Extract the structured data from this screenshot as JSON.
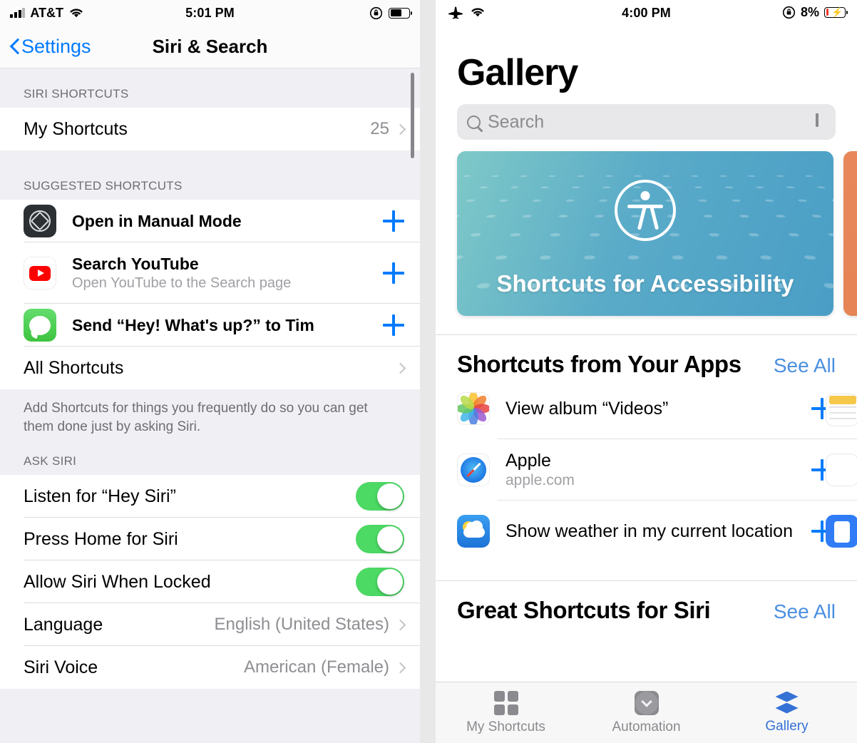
{
  "left": {
    "status": {
      "carrier": "AT&T",
      "time": "5:01 PM"
    },
    "nav": {
      "back": "Settings",
      "title": "Siri & Search"
    },
    "groups": [
      {
        "header": "SIRI SHORTCUTS",
        "rows": [
          {
            "title": "My Shortcuts",
            "value": "25"
          }
        ]
      },
      {
        "header": "SUGGESTED SHORTCUTS",
        "rows": [
          {
            "title": "Open in Manual Mode",
            "sub": "",
            "icon": "halide-icon"
          },
          {
            "title": "Search YouTube",
            "sub": "Open YouTube to the Search page",
            "icon": "youtube-icon"
          },
          {
            "title": "Send “Hey! What's up?” to Tim",
            "sub": "",
            "icon": "messages-icon"
          },
          {
            "title": "All Shortcuts"
          }
        ]
      }
    ],
    "footer_note": "Add Shortcuts for things you frequently do so you can get them done just by asking Siri.",
    "ask_siri_header": "ASK SIRI",
    "ask_siri_rows": [
      {
        "title": "Listen for “Hey Siri”",
        "toggle": "on"
      },
      {
        "title": "Press Home for Siri",
        "toggle": "on"
      },
      {
        "title": "Allow Siri When Locked",
        "toggle": "on"
      },
      {
        "title": "Language",
        "value": "English (United States)"
      },
      {
        "title": "Siri Voice",
        "value": "American (Female)"
      }
    ]
  },
  "right": {
    "status": {
      "time": "4:00 PM",
      "battery_pct": "8%"
    },
    "title": "Gallery",
    "search": {
      "placeholder": "Search"
    },
    "featured": [
      {
        "label": "Shortcuts for Accessibility",
        "color": "#4a9ec6"
      },
      {
        "label": "",
        "color": "#e07a4b"
      }
    ],
    "sections": [
      {
        "title": "Shortcuts from Your Apps",
        "see_all": "See All",
        "rows": [
          {
            "name": "View album “Videos”",
            "sub": "",
            "icon": "photos-icon"
          },
          {
            "name": "Apple",
            "sub": "apple.com",
            "icon": "safari-icon"
          },
          {
            "name": "Show weather in my current location",
            "sub": "",
            "icon": "weather-icon"
          }
        ]
      },
      {
        "title": "Great Shortcuts for Siri",
        "see_all": "See All",
        "rows": []
      }
    ],
    "tabs": [
      {
        "label": "My Shortcuts",
        "icon": "grid-icon",
        "active": false
      },
      {
        "label": "Automation",
        "icon": "automation-icon",
        "active": false
      },
      {
        "label": "Gallery",
        "icon": "layers-icon",
        "active": true
      }
    ]
  }
}
